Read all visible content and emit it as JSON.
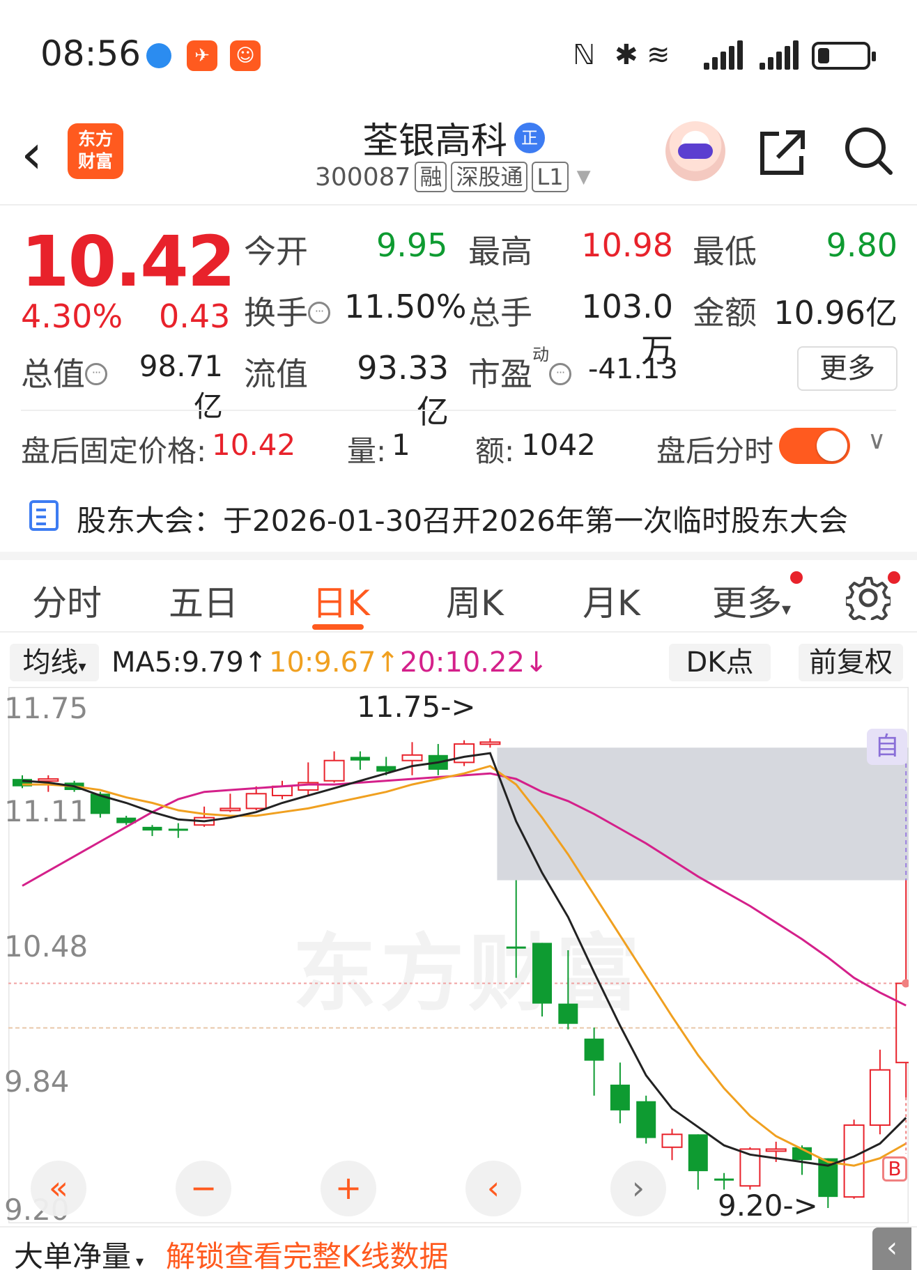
{
  "status_bar": {
    "time": "08:56"
  },
  "header": {
    "title": "荃银高科",
    "badge": "正",
    "code": "300087",
    "tags": [
      "融",
      "深股通",
      "L1"
    ],
    "logo_lines": [
      "东方",
      "财富"
    ]
  },
  "quote": {
    "price": "10.42",
    "change_pct": "4.30%",
    "change_abs": "0.43",
    "open_label": "今开",
    "open": "9.95",
    "high_label": "最高",
    "high": "10.98",
    "low_label": "最低",
    "low": "9.80",
    "turnover_label": "换手",
    "turnover": "11.50%",
    "volume_label": "总手",
    "volume": "103.0万",
    "amount_label": "金额",
    "amount": "10.96亿",
    "mktcap_label": "总值",
    "mktcap": "98.71亿",
    "float_label": "流值",
    "float": "93.33亿",
    "pe_label": "市盈",
    "pe_sup": "动",
    "pe": "-41.13",
    "more": "更多"
  },
  "after_hours": {
    "price_label": "盘后固定价格:",
    "price": "10.42",
    "vol_label": "量:",
    "vol": "1",
    "amt_label": "额:",
    "amt": "1042",
    "toggle_label": "盘后分时",
    "toggle_on": true
  },
  "notice": "股东大会：于2026-01-30召开2026年第一次临时股东大会",
  "tabs": [
    "分时",
    "五日",
    "日K",
    "周K",
    "月K",
    "更多"
  ],
  "active_tab": "日K",
  "ma_bar": {
    "selector": "均线",
    "ma5": "MA5:9.79↑",
    "ma10": "10:9.67↑",
    "ma20": "20:10.22↓",
    "dk": "DK点",
    "adjust": "前复权"
  },
  "colors": {
    "up": "#e8222b",
    "down": "#0e9b31",
    "ma5": "#222222",
    "ma10": "#f0a020",
    "ma20": "#d4208a",
    "accent": "#ff5a1f"
  },
  "chart_data": {
    "type": "candlestick",
    "y_ticks": [
      "11.75",
      "11.11",
      "10.48",
      "9.84",
      "9.20"
    ],
    "ylim": [
      9.2,
      11.75
    ],
    "annotations": {
      "high_marker": "11.75->",
      "low_marker": "9.20->"
    },
    "badges": {
      "auto": "自",
      "buy": "B"
    },
    "candles": [
      {
        "o": 11.53,
        "c": 11.49,
        "h": 11.55,
        "l": 11.48
      },
      {
        "o": 11.52,
        "c": 11.53,
        "h": 11.55,
        "l": 11.46
      },
      {
        "o": 11.51,
        "c": 11.47,
        "h": 11.52,
        "l": 11.46
      },
      {
        "o": 11.45,
        "c": 11.34,
        "h": 11.46,
        "l": 11.32
      },
      {
        "o": 11.32,
        "c": 11.29,
        "h": 11.33,
        "l": 11.28
      },
      {
        "o": 11.27,
        "c": 11.25,
        "h": 11.28,
        "l": 11.22
      },
      {
        "o": 11.26,
        "c": 11.25,
        "h": 11.29,
        "l": 11.21
      },
      {
        "o": 11.28,
        "c": 11.32,
        "h": 11.38,
        "l": 11.27
      },
      {
        "o": 11.36,
        "c": 11.37,
        "h": 11.45,
        "l": 11.35
      },
      {
        "o": 11.37,
        "c": 11.45,
        "h": 11.49,
        "l": 11.36
      },
      {
        "o": 11.44,
        "c": 11.49,
        "h": 11.52,
        "l": 11.42
      },
      {
        "o": 11.47,
        "c": 11.51,
        "h": 11.62,
        "l": 11.44
      },
      {
        "o": 11.52,
        "c": 11.63,
        "h": 11.68,
        "l": 11.51
      },
      {
        "o": 11.65,
        "c": 11.63,
        "h": 11.68,
        "l": 11.58
      },
      {
        "o": 11.6,
        "c": 11.57,
        "h": 11.65,
        "l": 11.55
      },
      {
        "o": 11.63,
        "c": 11.66,
        "h": 11.73,
        "l": 11.55
      },
      {
        "o": 11.66,
        "c": 11.58,
        "h": 11.72,
        "l": 11.55
      },
      {
        "o": 11.62,
        "c": 11.72,
        "h": 11.74,
        "l": 11.6
      },
      {
        "o": 11.72,
        "c": 11.73,
        "h": 11.75,
        "l": 11.7
      },
      {
        "o": 10.62,
        "c": 10.61,
        "h": 10.98,
        "l": 10.45
      },
      {
        "o": 10.64,
        "c": 10.31,
        "h": 10.64,
        "l": 10.24
      },
      {
        "o": 10.31,
        "c": 10.2,
        "h": 10.6,
        "l": 10.17
      },
      {
        "o": 10.12,
        "c": 10.0,
        "h": 10.18,
        "l": 9.81
      },
      {
        "o": 9.87,
        "c": 9.73,
        "h": 9.99,
        "l": 9.66
      },
      {
        "o": 9.78,
        "c": 9.58,
        "h": 9.81,
        "l": 9.55
      },
      {
        "o": 9.53,
        "c": 9.6,
        "h": 9.63,
        "l": 9.46
      },
      {
        "o": 9.6,
        "c": 9.4,
        "h": 9.6,
        "l": 9.3
      },
      {
        "o": 9.36,
        "c": 9.35,
        "h": 9.39,
        "l": 9.3
      },
      {
        "o": 9.32,
        "c": 9.52,
        "h": 9.53,
        "l": 9.3
      },
      {
        "o": 9.51,
        "c": 9.52,
        "h": 9.56,
        "l": 9.45
      },
      {
        "o": 9.53,
        "c": 9.46,
        "h": 9.54,
        "l": 9.38
      },
      {
        "o": 9.47,
        "c": 9.26,
        "h": 9.47,
        "l": 9.2
      },
      {
        "o": 9.26,
        "c": 9.65,
        "h": 9.68,
        "l": 9.25
      },
      {
        "o": 9.65,
        "c": 9.95,
        "h": 10.06,
        "l": 9.6
      },
      {
        "o": 9.99,
        "c": 10.42,
        "h": 10.98,
        "l": 9.8
      }
    ],
    "ma5": [
      11.52,
      11.51,
      11.49,
      11.44,
      11.4,
      11.35,
      11.31,
      11.3,
      11.32,
      11.35,
      11.4,
      11.44,
      11.48,
      11.52,
      11.56,
      11.6,
      11.62,
      11.65,
      11.67,
      11.3,
      11.02,
      10.78,
      10.48,
      10.19,
      9.92,
      9.74,
      9.64,
      9.54,
      9.49,
      9.47,
      9.45,
      9.43,
      9.48,
      9.55,
      9.69
    ],
    "ma10": [
      11.5,
      11.5,
      11.49,
      11.47,
      11.43,
      11.4,
      11.36,
      11.34,
      11.33,
      11.33,
      11.35,
      11.37,
      11.4,
      11.43,
      11.46,
      11.5,
      11.53,
      11.56,
      11.6,
      11.5,
      11.32,
      11.12,
      10.9,
      10.68,
      10.46,
      10.24,
      10.03,
      9.85,
      9.7,
      9.59,
      9.52,
      9.45,
      9.43,
      9.47,
      9.55
    ],
    "ma20": [
      10.95,
      11.03,
      11.11,
      11.19,
      11.27,
      11.35,
      11.42,
      11.46,
      11.47,
      11.48,
      11.49,
      11.5,
      11.5,
      11.51,
      11.52,
      11.53,
      11.54,
      11.55,
      11.56,
      11.53,
      11.46,
      11.41,
      11.34,
      11.26,
      11.18,
      11.09,
      11.0,
      10.92,
      10.84,
      10.75,
      10.66,
      10.56,
      10.45,
      10.37,
      10.3
    ]
  },
  "zoom_controls": [
    "«",
    "−",
    "+",
    "‹",
    "›"
  ],
  "bottom": {
    "selector": "大单净量",
    "cta": "解锁查看完整K线数据"
  }
}
